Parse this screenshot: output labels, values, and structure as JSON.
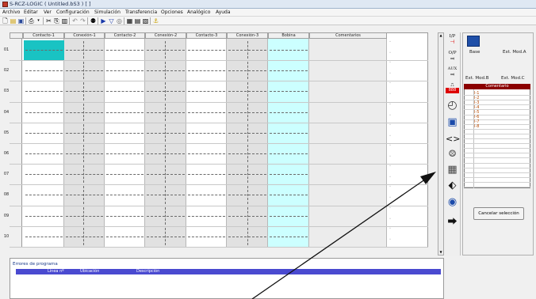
{
  "window": {
    "title": "S-RCZ-LOGIC  ( Untitled.bS3 ) [ ]"
  },
  "menu": [
    "Archivo",
    "Editar",
    "Ver",
    "Configuración",
    "Simulación",
    "Transferencia",
    "Opciones",
    "Analógico",
    "Ayuda"
  ],
  "ladder": {
    "columns": [
      "Contacto-1",
      "Conexión-1",
      "Contacto-2",
      "Conexión-2",
      "Contacto-3",
      "Conexión-3",
      "Bobina",
      "Comentarios"
    ],
    "rows": [
      "01",
      "02",
      "03",
      "04",
      "05",
      "06",
      "07",
      "08",
      "09",
      "10"
    ]
  },
  "errors": {
    "title": "Errores de programa",
    "columns": [
      "Línea nº",
      "Ubicación",
      "Descripción"
    ]
  },
  "palette": [
    {
      "label": "I/P",
      "icon": "input-icon"
    },
    {
      "label": "O/P",
      "icon": "output-icon"
    },
    {
      "label": "AUX",
      "icon": "auxiliary-relay-icon"
    },
    {
      "label": "",
      "icon": "timer-icon"
    },
    {
      "label": "",
      "icon": "clock-icon"
    },
    {
      "label": "",
      "icon": "counter-icon"
    },
    {
      "label": "",
      "icon": "compare-icon"
    },
    {
      "label": "",
      "icon": "analog-icon"
    },
    {
      "label": "",
      "icon": "keypad-icon"
    },
    {
      "label": "",
      "icon": "display-icon"
    },
    {
      "label": "",
      "icon": "rtc-icon"
    },
    {
      "label": "",
      "icon": "arrow-right-icon"
    }
  ],
  "module_panel": {
    "base": "Base",
    "ext_a": "Ext. Mod.A",
    "ext_b": "Ext. Mod.B",
    "ext_c": "Ext. Mod.C"
  },
  "comments": {
    "header": "Comentario",
    "ids": [
      "I-1",
      "I-2",
      "I-3",
      "I-4",
      "I-5",
      "I-6",
      "I-7",
      "I-8"
    ]
  },
  "cancel_button": "Cancelar selección",
  "colors": {
    "selected_cell": "#19c3c3",
    "coil_column": "#ccffff",
    "connection_column": "#e1e1e1",
    "comment_header": "#8b0000",
    "error_header": "#4a4ad0"
  }
}
